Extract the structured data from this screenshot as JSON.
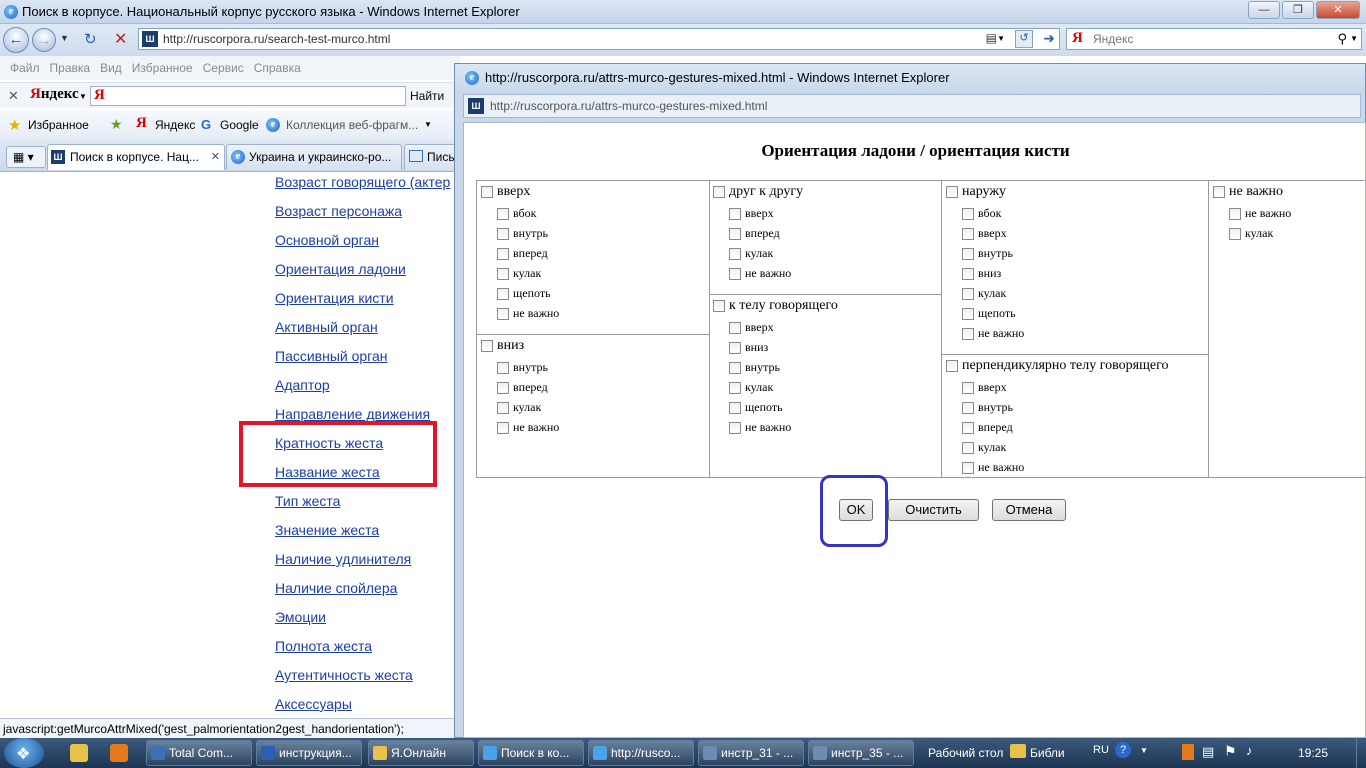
{
  "main_window": {
    "title": "Поиск в корпусе. Национальный корпус русского языка - Windows Internet Explorer",
    "address": "http://ruscorpora.ru/search-test-murco.html",
    "search_placeholder": "Яндекс",
    "menu": [
      "Файл",
      "Правка",
      "Вид",
      "Избранное",
      "Сервис",
      "Справка"
    ],
    "yandex_bar": {
      "brand": "Яндекс",
      "find_label": "Найти"
    },
    "favorites_bar": {
      "favorites": "Избранное",
      "items": [
        "Яндекс",
        "Google",
        "Коллекция веб-фрагм..."
      ]
    },
    "tabs": [
      "Поиск в корпусе. Нац...",
      "Украина и украинско-ро...",
      "Пись"
    ],
    "links": [
      "Возраст говорящего (актер",
      "Возраст персонажа",
      "Основной орган",
      "Ориентация ладони",
      "Ориентация кисти",
      "Активный орган",
      "Пассивный орган",
      "Адаптор",
      "Направление движения",
      "Кратность жеста",
      "Название жеста",
      "Тип жеста",
      "Значение жеста",
      "Наличие удлинителя",
      "Наличие спойлера",
      "Эмоции",
      "Полнота жеста",
      "Аутентичность жеста",
      "Аксессуары"
    ],
    "status": "javascript:getMurcoAttrMixed('gest_palmorientation2gest_handorientation');"
  },
  "popup": {
    "title": "http://ruscorpora.ru/attrs-murco-gestures-mixed.html - Windows Internet Explorer",
    "address": "http://ruscorpora.ru/attrs-murco-gestures-mixed.html",
    "heading": "Ориентация ладони / ориентация кисти",
    "columns": [
      {
        "groups": [
          {
            "label": "вверх",
            "options": [
              "вбок",
              "внутрь",
              "вперед",
              "кулак",
              "щепоть",
              "не важно"
            ]
          },
          {
            "label": "вниз",
            "options": [
              "внутрь",
              "вперед",
              "кулак",
              "не важно"
            ]
          }
        ]
      },
      {
        "groups": [
          {
            "label": "друг к другу",
            "options": [
              "вверх",
              "вперед",
              "кулак",
              "не важно"
            ]
          },
          {
            "label": "к телу говорящего",
            "options": [
              "вверх",
              "вниз",
              "внутрь",
              "кулак",
              "щепоть",
              "не важно"
            ]
          }
        ]
      },
      {
        "groups": [
          {
            "label": "наружу",
            "options": [
              "вбок",
              "вверх",
              "внутрь",
              "вниз",
              "кулак",
              "щепоть",
              "не важно"
            ]
          },
          {
            "label": "перпендикулярно телу говорящего",
            "options": [
              "вверх",
              "внутрь",
              "вперед",
              "кулак",
              "не важно"
            ]
          }
        ]
      },
      {
        "groups": [
          {
            "label": "не важно",
            "options": [
              "не важно",
              "кулак"
            ]
          }
        ]
      }
    ],
    "buttons": {
      "ok": "OK",
      "clear": "Очистить",
      "cancel": "Отмена"
    }
  },
  "taskbar": {
    "items": [
      "Total Com...",
      "инструкция...",
      "Я.Онлайн",
      "Поиск в ко...",
      "http://rusco...",
      "инстр_31 - ...",
      "инстр_35 - ..."
    ],
    "desktop": "Рабочий стол",
    "libraries": "Библи",
    "lang": "RU",
    "time": "19:25"
  }
}
